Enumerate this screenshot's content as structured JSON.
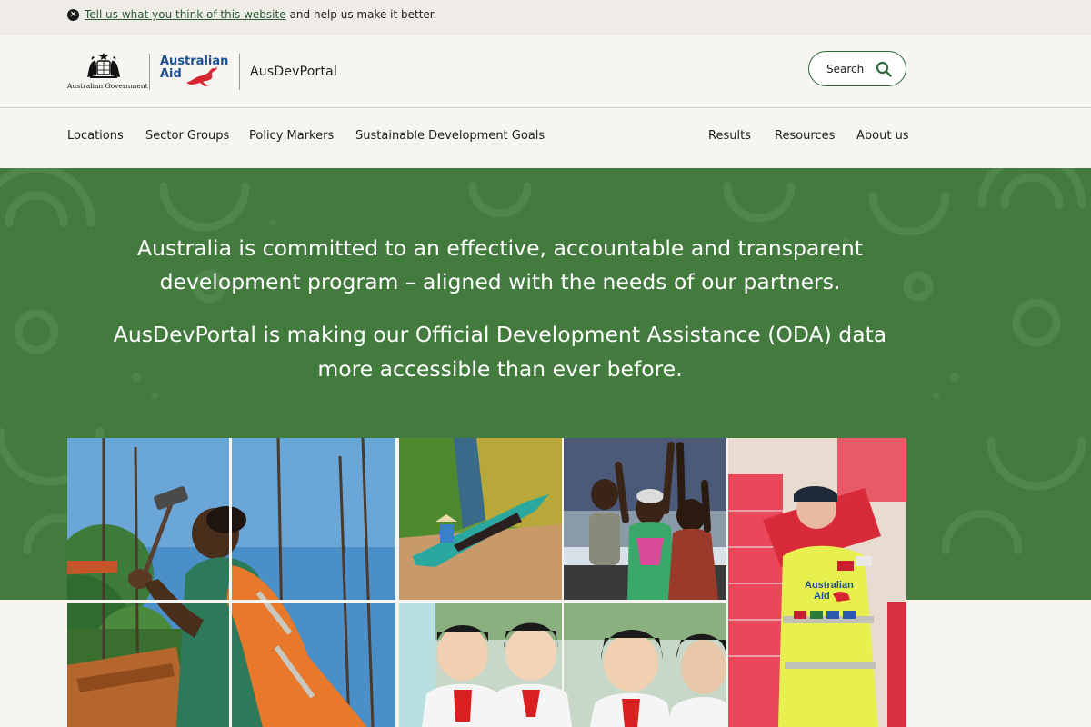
{
  "feedback": {
    "link_text": "Tell us what you think of this website",
    "rest_text": "and help us make it better.",
    "close_glyph": "×"
  },
  "header": {
    "gov_label": "Australian Government",
    "aid_line1": "Australian",
    "aid_line2": "Aid",
    "portal_name": "AusDevPortal",
    "search_label": "Search"
  },
  "nav": {
    "left": [
      "Locations",
      "Sector Groups",
      "Policy Markers",
      "Sustainable Development Goals"
    ],
    "right": [
      "Results",
      "Resources",
      "About us"
    ]
  },
  "hero": {
    "paragraph1": "Australia is committed to an effective, accountable and transparent development program – aligned with the needs of our partners.",
    "paragraph2": "AusDevPortal is making our Official Development Assistance (ODA) data more accessible than ever before."
  },
  "photos": {
    "vest_line1": "Australian",
    "vest_line2": "Aid"
  },
  "colors": {
    "hero_green": "#437b3e",
    "brand_blue": "#1d4f91",
    "brand_red": "#d6262f",
    "link_green": "#2a5934"
  }
}
